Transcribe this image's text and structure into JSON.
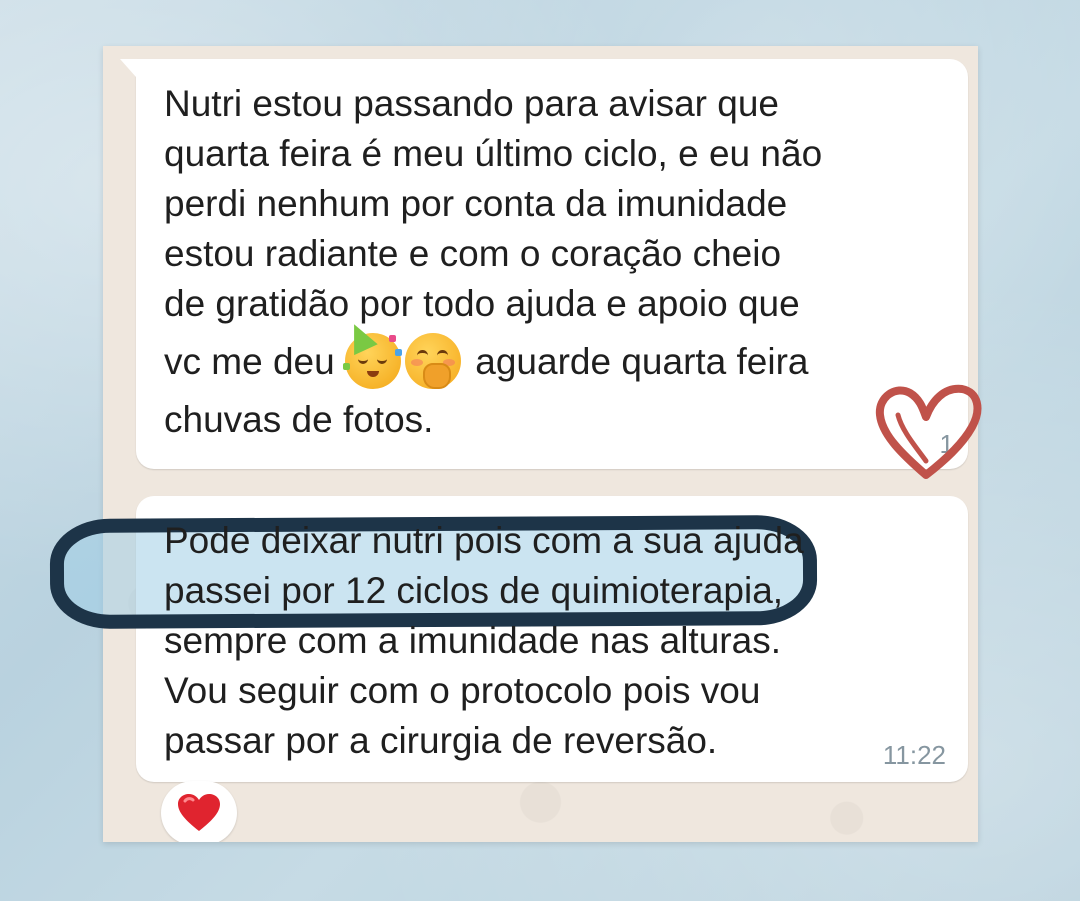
{
  "chat": {
    "received_message": {
      "lines": [
        "Nutri  estou passando para avisar que",
        "quarta feira é meu último ciclo,  e eu não",
        "perdi nenhum por conta da imunidade",
        "estou radiante e com o coração  cheio",
        "de gratidão  por todo ajuda e apoio que",
        "vc me deu",
        "aguarde quarta feira",
        "chuvas de fotos."
      ],
      "emojis": [
        "partying-face-icon",
        "face-with-hand-over-mouth-icon"
      ],
      "time": "1"
    },
    "reply_message": {
      "lines": [
        "Pode deixar nutri  pois com a sua ajuda",
        "passei por 12 ciclos de quimioterapia,",
        "sempre com a imunidade  nas alturas.",
        "Vou seguir com o protocolo  pois vou",
        "passar por a cirurgia  de reversão."
      ],
      "time": "11:22",
      "reaction": "red-heart-icon"
    }
  },
  "annotations": {
    "highlight_color": "#1d3448",
    "heart_doodle_color": "#c0524a"
  }
}
